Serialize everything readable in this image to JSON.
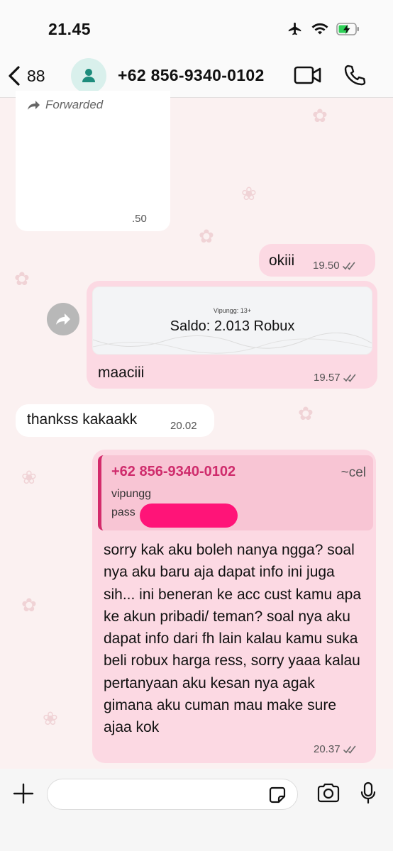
{
  "status": {
    "time": "21.45"
  },
  "header": {
    "back_count": "88",
    "contact_name": "+62 856-9340-0102"
  },
  "messages": {
    "forwarded": {
      "label": "Forwarded",
      "time": ".50"
    },
    "okiii": {
      "text": "okiii",
      "time": "19.50"
    },
    "image": {
      "sub": "Vipungg: 13+",
      "main": "Saldo: 2.013 Robux",
      "caption": "maaciii",
      "time": "19.57"
    },
    "thankss": {
      "text": "thankss kakaakk",
      "time": "20.02"
    },
    "reply": {
      "quote_name": "+62 856-9340-0102",
      "quote_author": "~cel",
      "quote_line1": "vipungg",
      "quote_line2": "pass",
      "text": "sorry kak aku boleh nanya ngga? soal nya aku baru aja dapat info ini juga sih... ini beneran ke acc cust kamu apa ke akun pribadi/ teman? soal nya aku dapat info dari fh lain kalau kamu suka beli robux harga ress, sorry yaaa kalau pertanyaan aku kesan nya agak gimana aku cuman mau make sure ajaa kok",
      "time": "20.37"
    }
  },
  "colors": {
    "outgoing_bubble": "#fcd9e3",
    "quote_accent": "#d32b6b",
    "redaction": "#ff1478",
    "avatar_bg": "#d9f0ec",
    "tick": "#6b6b6b"
  }
}
